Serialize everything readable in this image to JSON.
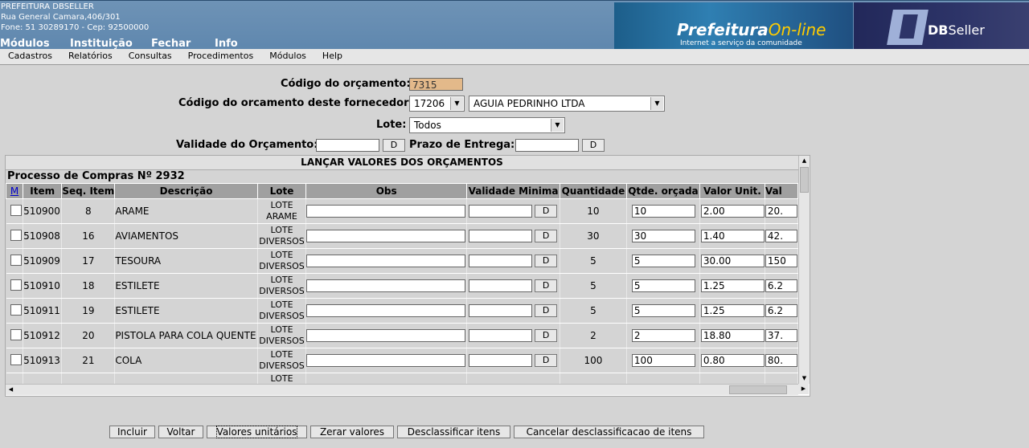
{
  "header": {
    "org_name": "PREFEITURA DBSELLER",
    "address": "Rua General Camara,406/301",
    "phone": "Fone: 51 30289170  -  Cep: 92500000",
    "menu": [
      "Módulos",
      "Instituição",
      "Fechar",
      "Info"
    ],
    "brand_main": "Prefeitura",
    "brand_online": "On-line",
    "brand_tagline": "Internet a serviço da comunidade",
    "dbseller_bold": "DB",
    "dbseller_light": "Seller"
  },
  "menubar": [
    "Cadastros",
    "Relatórios",
    "Consultas",
    "Procedimentos",
    "Módulos",
    "Help"
  ],
  "form": {
    "codigo_label": "Código do orçamento:",
    "codigo_value": "7315",
    "fornecedor_label": "Código do orcamento deste fornecedor:",
    "fornecedor_code": "17206",
    "fornecedor_name": "AGUIA PEDRINHO LTDA",
    "lote_label": "Lote:",
    "lote_value": "Todos",
    "validade_label": "Validade do Orçamento:",
    "validade_value": "",
    "prazo_label": "Prazo de Entrega:",
    "prazo_value": "",
    "d_label": "D"
  },
  "table": {
    "section_title": "LANÇAR VALORES DOS ORÇAMENTOS",
    "process_title": "Processo de Compras Nº 2932",
    "headers": [
      "M",
      "Item",
      "Seq. Item",
      "Descrição",
      "Lote",
      "Obs",
      "Validade Minima",
      "Quantidade",
      "Qtde. orçada",
      "Valor Unit.",
      "Val"
    ],
    "rows": [
      {
        "item": "510900",
        "seq": "8",
        "desc": "ARAME",
        "lote1": "LOTE",
        "lote2": "ARAME",
        "obs": "",
        "validade": "",
        "qtd": "10",
        "qtde_orcada": "10",
        "valor_unit": "2.00",
        "valor_total": "20."
      },
      {
        "item": "510908",
        "seq": "16",
        "desc": "AVIAMENTOS",
        "lote1": "LOTE",
        "lote2": "DIVERSOS",
        "obs": "",
        "validade": "",
        "qtd": "30",
        "qtde_orcada": "30",
        "valor_unit": "1.40",
        "valor_total": "42."
      },
      {
        "item": "510909",
        "seq": "17",
        "desc": "TESOURA",
        "lote1": "LOTE",
        "lote2": "DIVERSOS",
        "obs": "",
        "validade": "",
        "qtd": "5",
        "qtde_orcada": "5",
        "valor_unit": "30.00",
        "valor_total": "150"
      },
      {
        "item": "510910",
        "seq": "18",
        "desc": "ESTILETE",
        "lote1": "LOTE",
        "lote2": "DIVERSOS",
        "obs": "",
        "validade": "",
        "qtd": "5",
        "qtde_orcada": "5",
        "valor_unit": "1.25",
        "valor_total": "6.2"
      },
      {
        "item": "510911",
        "seq": "19",
        "desc": "ESTILETE",
        "lote1": "LOTE",
        "lote2": "DIVERSOS",
        "obs": "",
        "validade": "",
        "qtd": "5",
        "qtde_orcada": "5",
        "valor_unit": "1.25",
        "valor_total": "6.2"
      },
      {
        "item": "510912",
        "seq": "20",
        "desc": "PISTOLA PARA COLA QUENTE",
        "lote1": "LOTE",
        "lote2": "DIVERSOS",
        "obs": "",
        "validade": "",
        "qtd": "2",
        "qtde_orcada": "2",
        "valor_unit": "18.80",
        "valor_total": "37."
      },
      {
        "item": "510913",
        "seq": "21",
        "desc": "COLA",
        "lote1": "LOTE",
        "lote2": "DIVERSOS",
        "obs": "",
        "validade": "",
        "qtd": "100",
        "qtde_orcada": "100",
        "valor_unit": "0.80",
        "valor_total": "80."
      }
    ],
    "partial_row_lote": "LOTE"
  },
  "buttons": [
    "Incluir",
    "Voltar",
    "Valores unitários",
    "Zerar valores",
    "Desclassificar itens",
    "Cancelar desclassificacao de itens"
  ]
}
